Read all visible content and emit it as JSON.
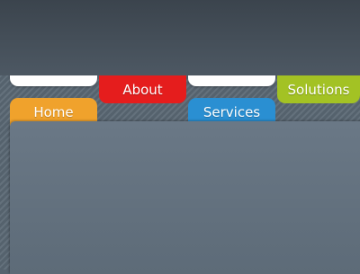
{
  "nav": {
    "tabs": [
      {
        "label": "Home",
        "color": "#f0a22c"
      },
      {
        "label": "About",
        "color": "#e51d1d"
      },
      {
        "label": "Services",
        "color": "#2a8fd2"
      },
      {
        "label": "Solutions",
        "color": "#a3c224"
      }
    ],
    "strip_color": "#ffffff"
  }
}
